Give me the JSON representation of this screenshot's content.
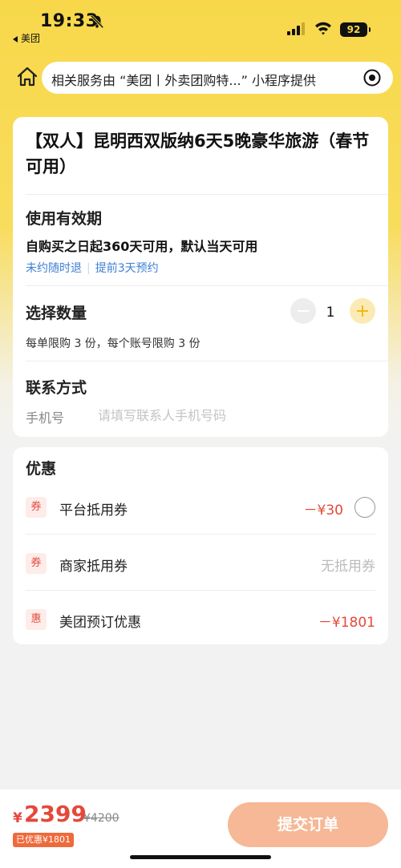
{
  "status_bar": {
    "time": "19:33",
    "back_app": "美团",
    "battery": "92"
  },
  "notice": {
    "text": "相关服务由 “美团丨外卖团购特...” 小程序提供"
  },
  "product": {
    "title": "【双人】昆明西双版纳6天5晚豪华旅游（春节可用）"
  },
  "validity": {
    "heading": "使用有效期",
    "text": "自购买之日起360天可用，默认当天可用",
    "tag_refund": "未约随时退",
    "tag_book": "提前3天预约"
  },
  "quantity": {
    "heading": "选择数量",
    "value": "1",
    "limit_text": "每单限购 3 份，每个账号限购 3 份"
  },
  "contact": {
    "heading": "联系方式",
    "phone_label": "手机号",
    "phone_placeholder": "请填写联系人手机号码",
    "phone_value": ""
  },
  "discounts": {
    "heading": "优惠",
    "items": [
      {
        "badge": "券",
        "label": "平台抵用券",
        "amount": "－¥30",
        "selected": false
      },
      {
        "badge": "券",
        "label": "商家抵用券",
        "amount": "无抵用券"
      },
      {
        "badge": "惠",
        "label": "美团预订优惠",
        "amount": "－¥1801"
      }
    ]
  },
  "bottom": {
    "currency": "¥",
    "price": "2399",
    "original_price": "¥4200",
    "saved": "已优惠¥1801",
    "submit_label": "提交订单"
  },
  "colors": {
    "brand_yellow": "#F8D84A",
    "discount_red": "#E5483A",
    "link_blue": "#3C7FD4",
    "submit_btn": "#F6B896"
  }
}
